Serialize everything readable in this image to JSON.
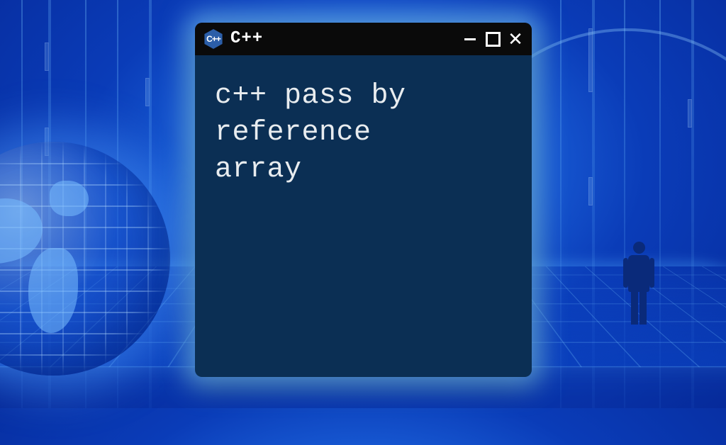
{
  "window": {
    "logo_text": "C++",
    "title": "C++",
    "content_text": "c++ pass by\nreference\narray"
  },
  "controls": {
    "minimize": "minimize",
    "maximize": "maximize",
    "close": "✕"
  }
}
